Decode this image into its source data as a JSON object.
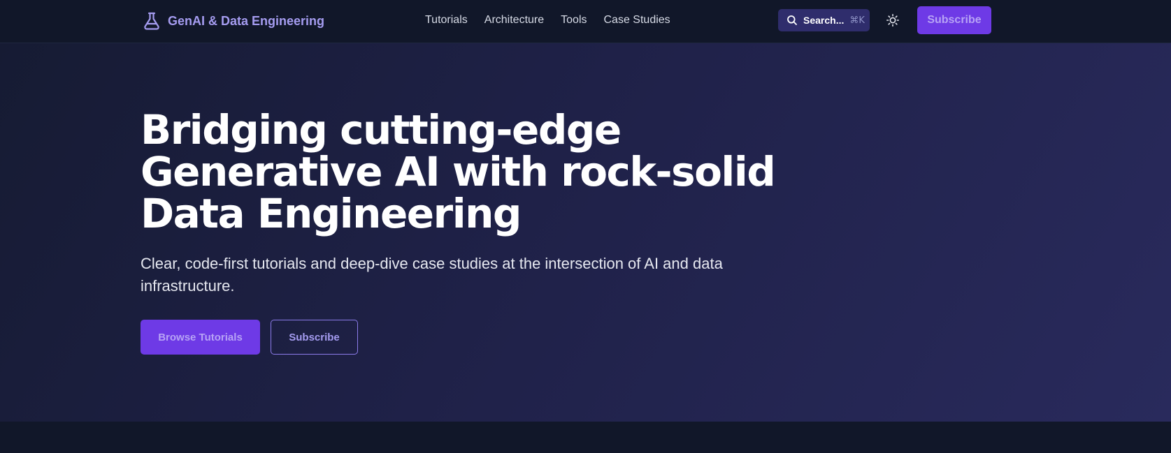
{
  "header": {
    "brand": {
      "name": "GenAI & Data Engineering",
      "icon": "flask-icon"
    },
    "nav": [
      {
        "label": "Tutorials"
      },
      {
        "label": "Architecture"
      },
      {
        "label": "Tools"
      },
      {
        "label": "Case Studies"
      }
    ],
    "search": {
      "label": "Search...",
      "shortcut": "⌘K",
      "icon": "search-icon"
    },
    "theme_toggle": {
      "icon": "sun-icon"
    },
    "subscribe_label": "Subscribe"
  },
  "hero": {
    "title": "Bridging cutting-edge Generative AI with rock-solid Data Engineering",
    "subtitle": "Clear, code-first tutorials and deep-dive case studies at the intersection of AI and data infrastructure.",
    "primary_button": "Browse Tutorials",
    "secondary_button": "Subscribe"
  },
  "colors": {
    "page_bg": "#111729",
    "accent": "#6e3ae6",
    "accent_text": "#b7a3f5",
    "brand_text": "#a59cf0",
    "search_bg": "#2f2d6c"
  }
}
